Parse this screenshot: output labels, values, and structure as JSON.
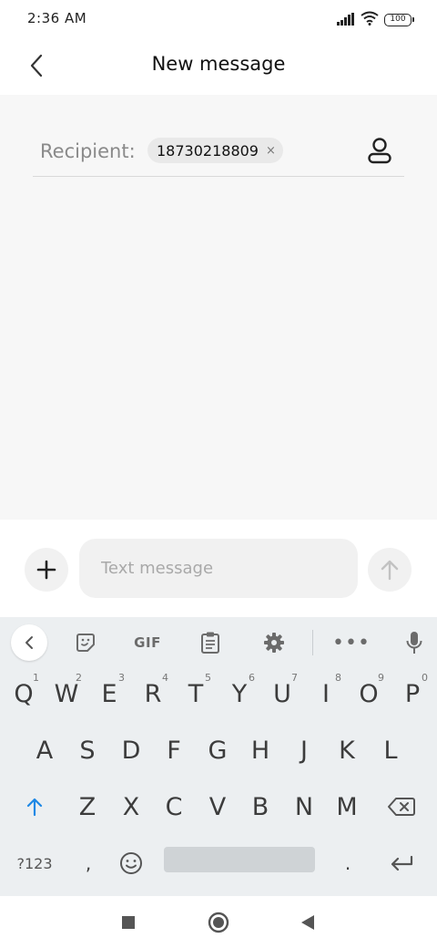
{
  "status_bar": {
    "time": "2:36 AM",
    "battery_level": "100",
    "icons": [
      "signal-icon",
      "wifi-icon",
      "battery-icon"
    ]
  },
  "header": {
    "title": "New message",
    "back_icon": "chevron-left-icon"
  },
  "recipient": {
    "label": "Recipient:",
    "chips": [
      "18730218809"
    ],
    "remove_glyph": "×",
    "contact_icon": "contact-person-icon"
  },
  "compose": {
    "placeholder": "Text message",
    "attach_icon": "plus-icon",
    "send_icon": "arrow-up-icon"
  },
  "keyboard": {
    "toolbar": {
      "gif_label": "GIF",
      "more_label": "•••",
      "items": [
        "chevron-left-icon",
        "sticker-icon",
        "gif-button",
        "clipboard-icon",
        "gear-icon",
        "more-icon",
        "microphone-icon"
      ]
    },
    "rows": [
      [
        {
          "char": "Q",
          "hint": "1"
        },
        {
          "char": "W",
          "hint": "2"
        },
        {
          "char": "E",
          "hint": "3"
        },
        {
          "char": "R",
          "hint": "4"
        },
        {
          "char": "T",
          "hint": "5"
        },
        {
          "char": "Y",
          "hint": "6"
        },
        {
          "char": "U",
          "hint": "7"
        },
        {
          "char": "I",
          "hint": "8"
        },
        {
          "char": "O",
          "hint": "9"
        },
        {
          "char": "P",
          "hint": "0"
        }
      ],
      [
        {
          "char": "A"
        },
        {
          "char": "S"
        },
        {
          "char": "D"
        },
        {
          "char": "F"
        },
        {
          "char": "G"
        },
        {
          "char": "H"
        },
        {
          "char": "J"
        },
        {
          "char": "K"
        },
        {
          "char": "L"
        }
      ],
      [
        {
          "char": "Z"
        },
        {
          "char": "X"
        },
        {
          "char": "C"
        },
        {
          "char": "V"
        },
        {
          "char": "B"
        },
        {
          "char": "N"
        },
        {
          "char": "M"
        }
      ]
    ],
    "bottom": {
      "symbols_label": "?123",
      "comma_label": ",",
      "period_label": ".",
      "emoji_icon": "emoji-icon",
      "enter_icon": "enter-icon",
      "shift_icon": "shift-icon",
      "backspace_icon": "backspace-icon"
    },
    "accent_color": "#1e88e5"
  },
  "nav_bar": {
    "icons": [
      "square-icon",
      "home-circle-icon",
      "back-triangle-icon"
    ]
  }
}
